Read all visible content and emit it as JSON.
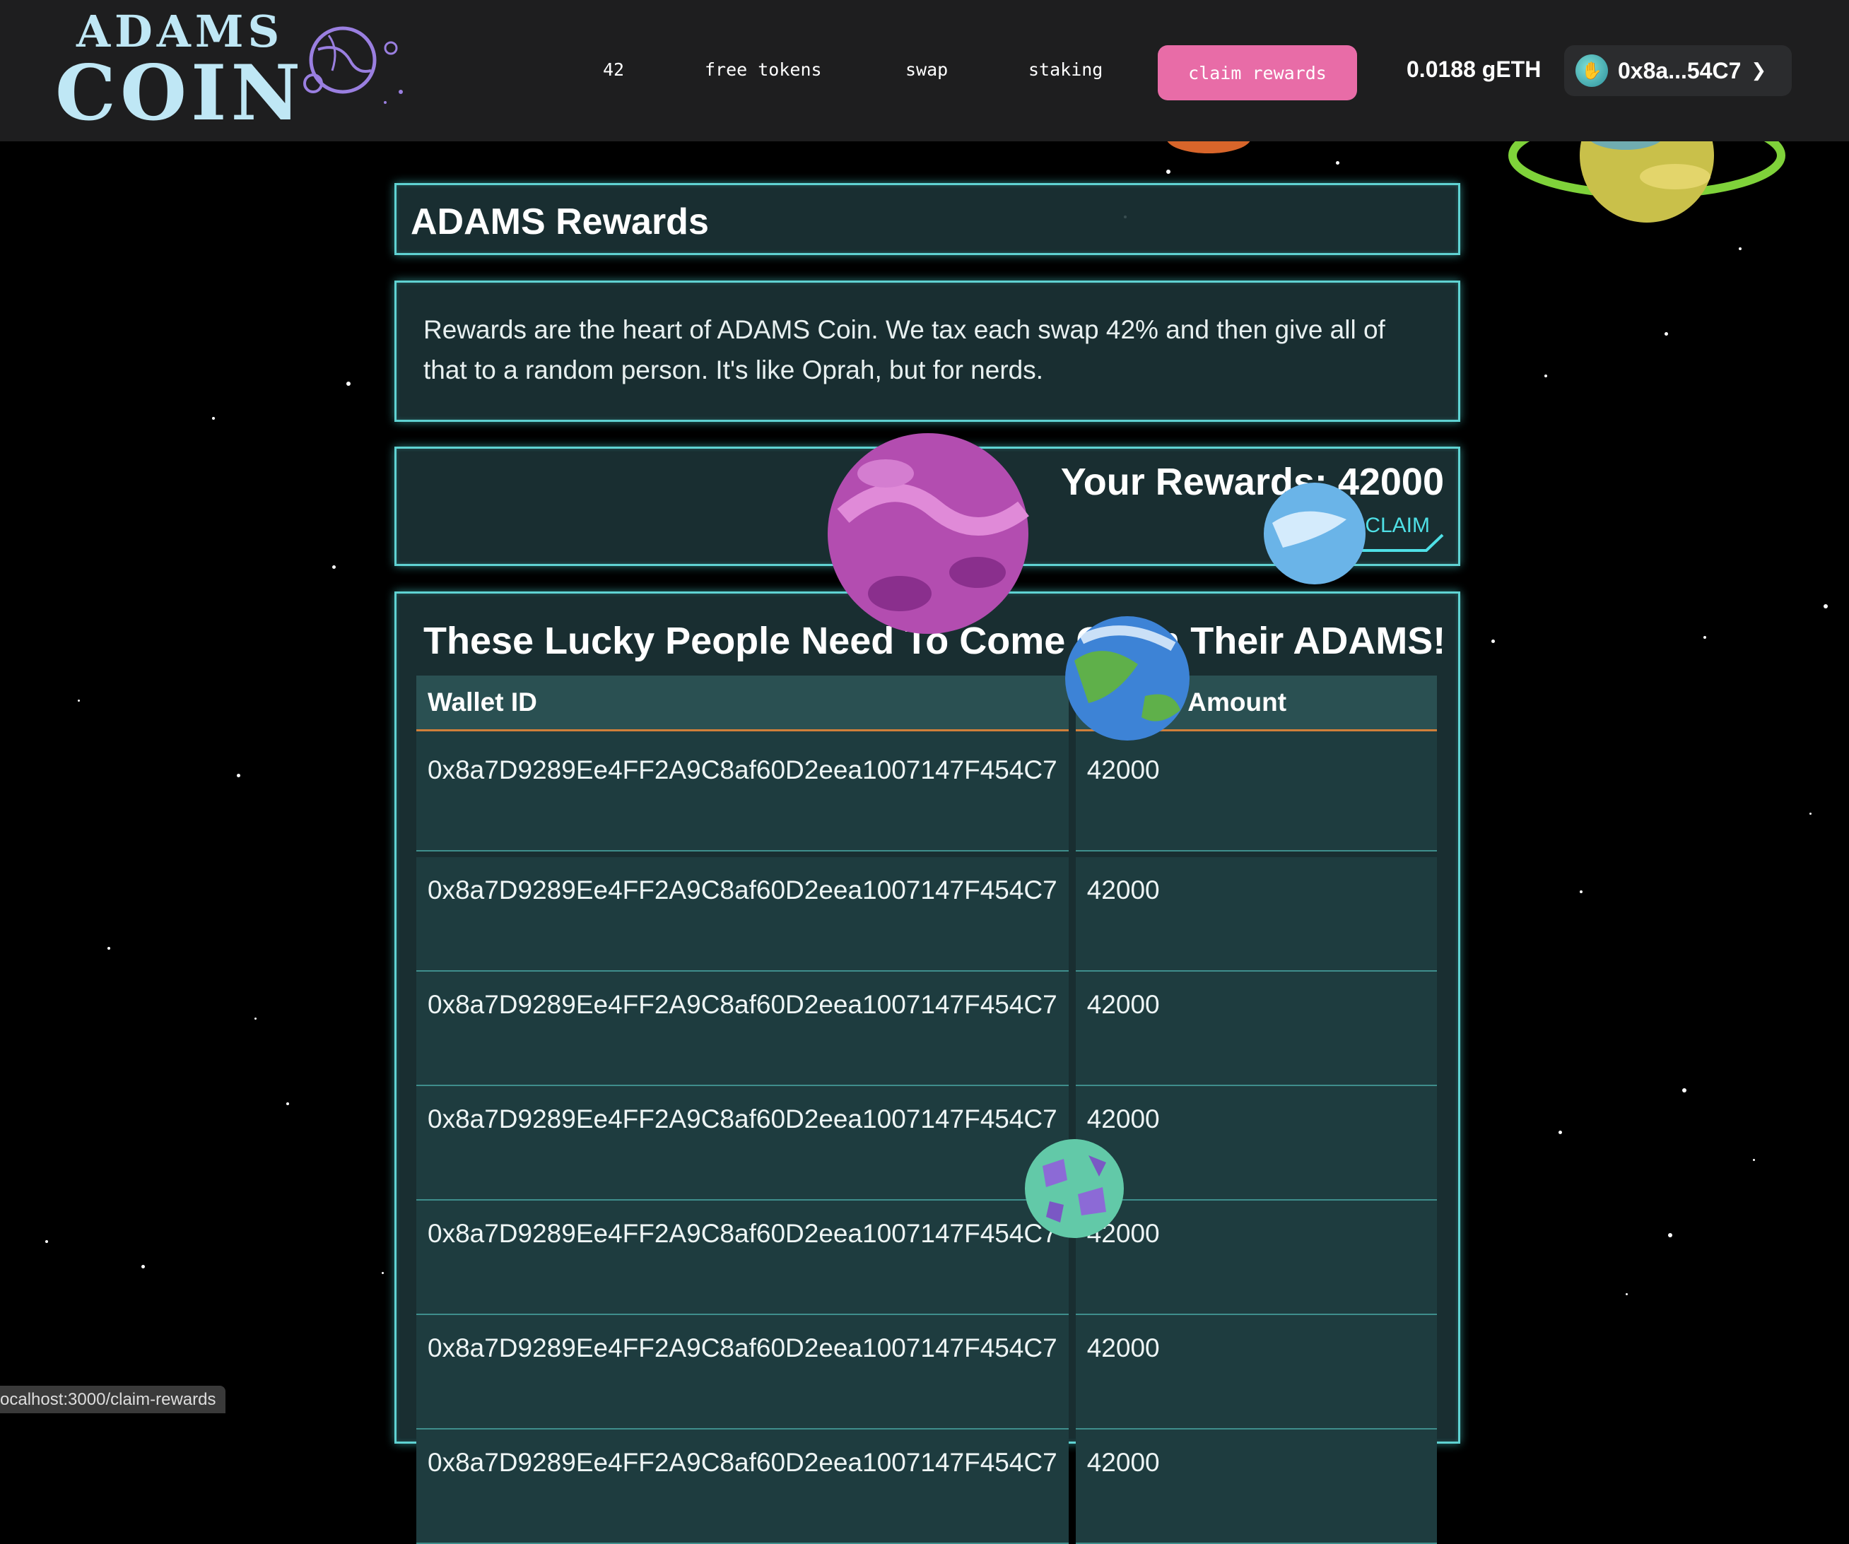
{
  "logo": {
    "line1": "ADAMS",
    "line2": "COIN"
  },
  "nav": {
    "links": [
      {
        "label": "42"
      },
      {
        "label": "free tokens"
      },
      {
        "label": "swap"
      },
      {
        "label": "staking"
      }
    ],
    "claim_rewards": "claim rewards"
  },
  "wallet": {
    "balance": "0.0188 gETH",
    "address": "0x8a...54C7"
  },
  "page": {
    "title": "ADAMS Rewards",
    "description": "Rewards are the heart of ADAMS Coin. We tax each swap 42% and then give all of that to a random person. It's like Oprah, but for nerds.",
    "your_rewards": "Your Rewards: 42000",
    "claim_label": "CLAIM"
  },
  "table": {
    "heading": "These Lucky People Need To Come Claim Their ADAMS!",
    "columns": [
      "Wallet ID",
      "Reward Amount"
    ],
    "rows": [
      {
        "wallet": "0x8a7D9289Ee4FF2A9C8af60D2eea1007147F454C7",
        "amount": "42000"
      },
      {
        "wallet": "0x8a7D9289Ee4FF2A9C8af60D2eea1007147F454C7",
        "amount": "42000"
      },
      {
        "wallet": "0x8a7D9289Ee4FF2A9C8af60D2eea1007147F454C7",
        "amount": "42000"
      },
      {
        "wallet": "0x8a7D9289Ee4FF2A9C8af60D2eea1007147F454C7",
        "amount": "42000"
      },
      {
        "wallet": "0x8a7D9289Ee4FF2A9C8af60D2eea1007147F454C7",
        "amount": "42000"
      },
      {
        "wallet": "0x8a7D9289Ee4FF2A9C8af60D2eea1007147F454C7",
        "amount": "42000"
      },
      {
        "wallet": "0x8a7D9289Ee4FF2A9C8af60D2eea1007147F454C7",
        "amount": "42000"
      }
    ]
  },
  "status_bar": {
    "url": "ocalhost:3000/claim-rewards"
  },
  "colors": {
    "accent_pink": "#e86ca7",
    "panel_border": "#5fd2d2",
    "header_bg": "#1e1e1f"
  }
}
